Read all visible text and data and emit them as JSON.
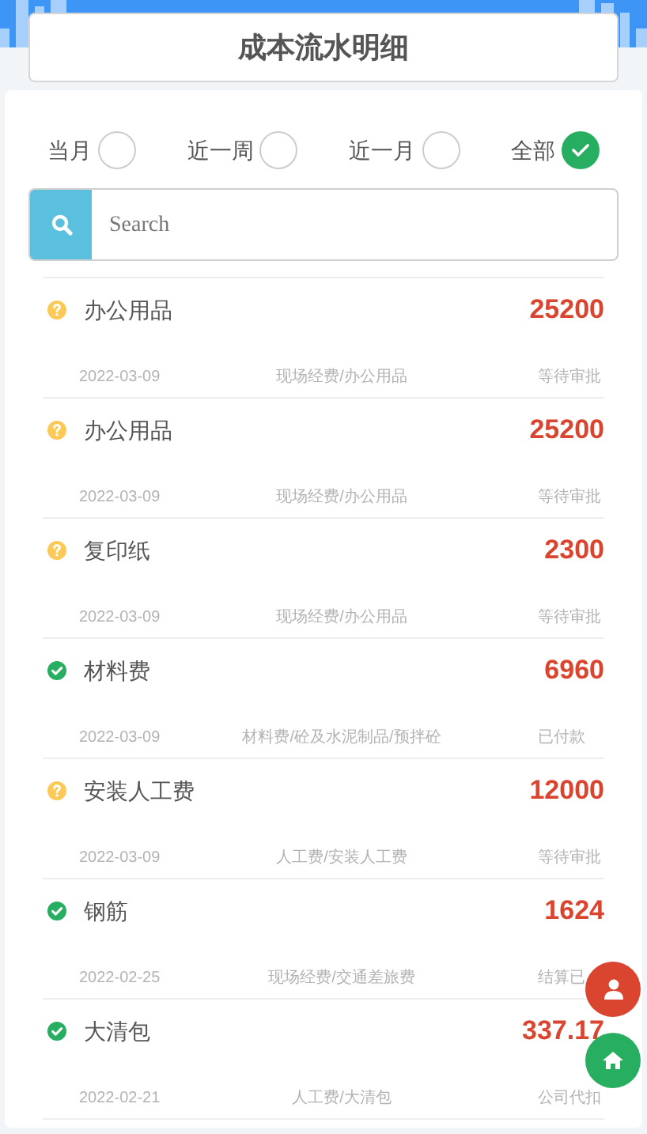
{
  "header": {
    "title": "成本流水明细"
  },
  "filters": [
    {
      "label": "当月",
      "selected": false
    },
    {
      "label": "近一周",
      "selected": false
    },
    {
      "label": "近一月",
      "selected": false
    },
    {
      "label": "全部",
      "selected": true
    }
  ],
  "search": {
    "placeholder": "Search"
  },
  "records": [
    {
      "kind": "pending",
      "name": "办公用品",
      "amount": "25200",
      "date": "2022-03-09",
      "category": "现场经费/办公用品",
      "status": "等待审批"
    },
    {
      "kind": "pending",
      "name": "办公用品",
      "amount": "25200",
      "date": "2022-03-09",
      "category": "现场经费/办公用品",
      "status": "等待审批"
    },
    {
      "kind": "pending",
      "name": "复印纸",
      "amount": "2300",
      "date": "2022-03-09",
      "category": "现场经费/办公用品",
      "status": "等待审批"
    },
    {
      "kind": "approved",
      "name": "材料费",
      "amount": "6960",
      "date": "2022-03-09",
      "category": "材料费/砼及水泥制品/预拌砼",
      "status": "已付款"
    },
    {
      "kind": "pending",
      "name": "安装人工费",
      "amount": "12000",
      "date": "2022-03-09",
      "category": "人工费/安装人工费",
      "status": "等待审批"
    },
    {
      "kind": "approved",
      "name": "钢筋",
      "amount": "1624",
      "date": "2022-02-25",
      "category": "现场经费/交通差旅费",
      "status": "结算已"
    },
    {
      "kind": "approved",
      "name": "大清包",
      "amount": "337.17",
      "date": "2022-02-21",
      "category": "人工费/大清包",
      "status": "公司代扣"
    }
  ]
}
